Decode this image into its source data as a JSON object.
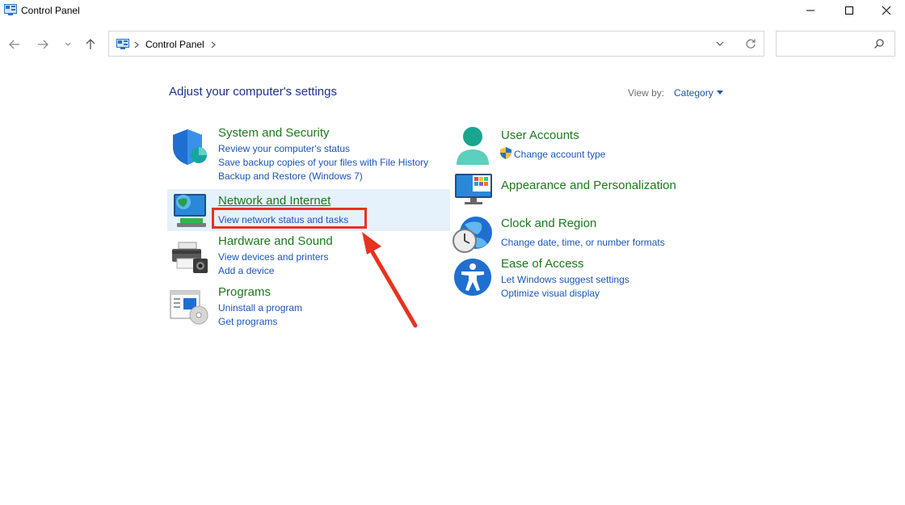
{
  "window": {
    "title": "Control Panel",
    "controls": {
      "minimize": "minimize-icon",
      "maximize": "maximize-icon",
      "close": "close-icon"
    }
  },
  "address_bar": {
    "breadcrumb": "Control Panel",
    "search_placeholder": ""
  },
  "main": {
    "heading": "Adjust your computer's settings",
    "view_by_label": "View by:",
    "view_by_value": "Category"
  },
  "categories": {
    "system_security": {
      "title": "System and Security",
      "links": [
        "Review your computer's status",
        "Save backup copies of your files with File History",
        "Backup and Restore (Windows 7)"
      ]
    },
    "network_internet": {
      "title": "Network and Internet",
      "links": [
        "View network status and tasks"
      ]
    },
    "hardware_sound": {
      "title": "Hardware and Sound",
      "links": [
        "View devices and printers",
        "Add a device"
      ]
    },
    "programs": {
      "title": "Programs",
      "links": [
        "Uninstall a program",
        "Get programs"
      ]
    },
    "user_accounts": {
      "title": "User Accounts",
      "links": [
        "Change account type"
      ]
    },
    "appearance": {
      "title": "Appearance and Personalization",
      "links": []
    },
    "clock_region": {
      "title": "Clock and Region",
      "links": [
        "Change date, time, or number formats"
      ]
    },
    "ease_access": {
      "title": "Ease of Access",
      "links": [
        "Let Windows suggest settings",
        "Optimize visual display"
      ]
    }
  },
  "colors": {
    "category_title": "#1a7a1a",
    "link": "#1a55b8",
    "heading": "#1e3287",
    "highlight_bg": "#e5f1fb",
    "annotation_red": "#e8321f"
  }
}
